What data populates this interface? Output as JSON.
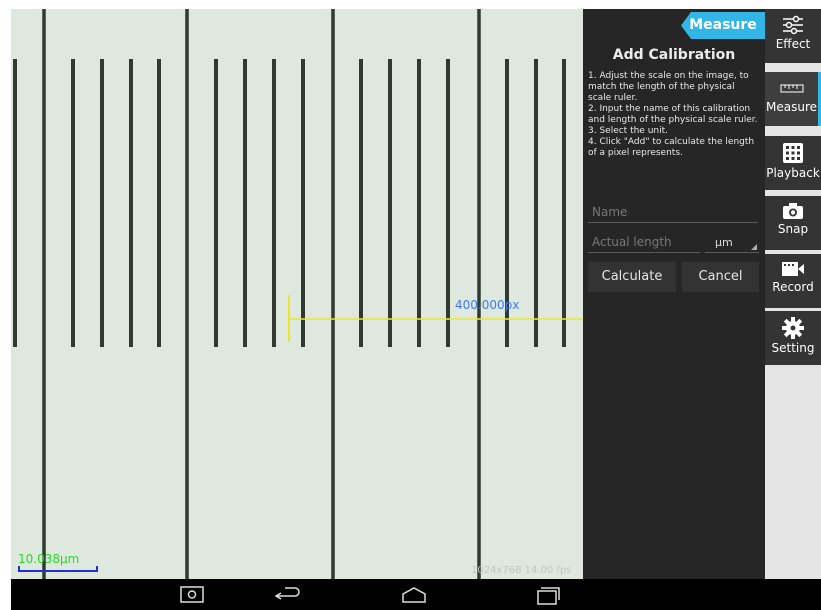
{
  "viewer": {
    "scale_label": "10.038µm",
    "measure_label": "400.000px",
    "resolution_label": "1024x768  14.00 fps"
  },
  "panel": {
    "tab_label": "Measure",
    "title": "Add Calibration",
    "instructions": [
      "1. Adjust the scale on the image, to match the length of the physical scale ruler.",
      "2. Input the name of this calibration and length of the physical scale ruler.",
      "3. Select the unit.",
      "4. Click \"Add\" to calculate the length of a pixel represents."
    ],
    "name_placeholder": "Name",
    "length_placeholder": "Actual length",
    "unit_value": "µm",
    "calculate_label": "Calculate",
    "cancel_label": "Cancel"
  },
  "sidebar": {
    "items": [
      {
        "label": "Effect",
        "icon": "sliders-icon"
      },
      {
        "label": "Measure",
        "icon": "ruler-icon"
      },
      {
        "label": "Playback",
        "icon": "grid-icon"
      },
      {
        "label": "Snap",
        "icon": "camera-icon"
      },
      {
        "label": "Record",
        "icon": "video-icon"
      },
      {
        "label": "Setting",
        "icon": "gear-icon"
      }
    ]
  },
  "colors": {
    "accent": "#33b5e5",
    "measure_line": "#e8e82a",
    "scale_text": "#22dd22"
  }
}
